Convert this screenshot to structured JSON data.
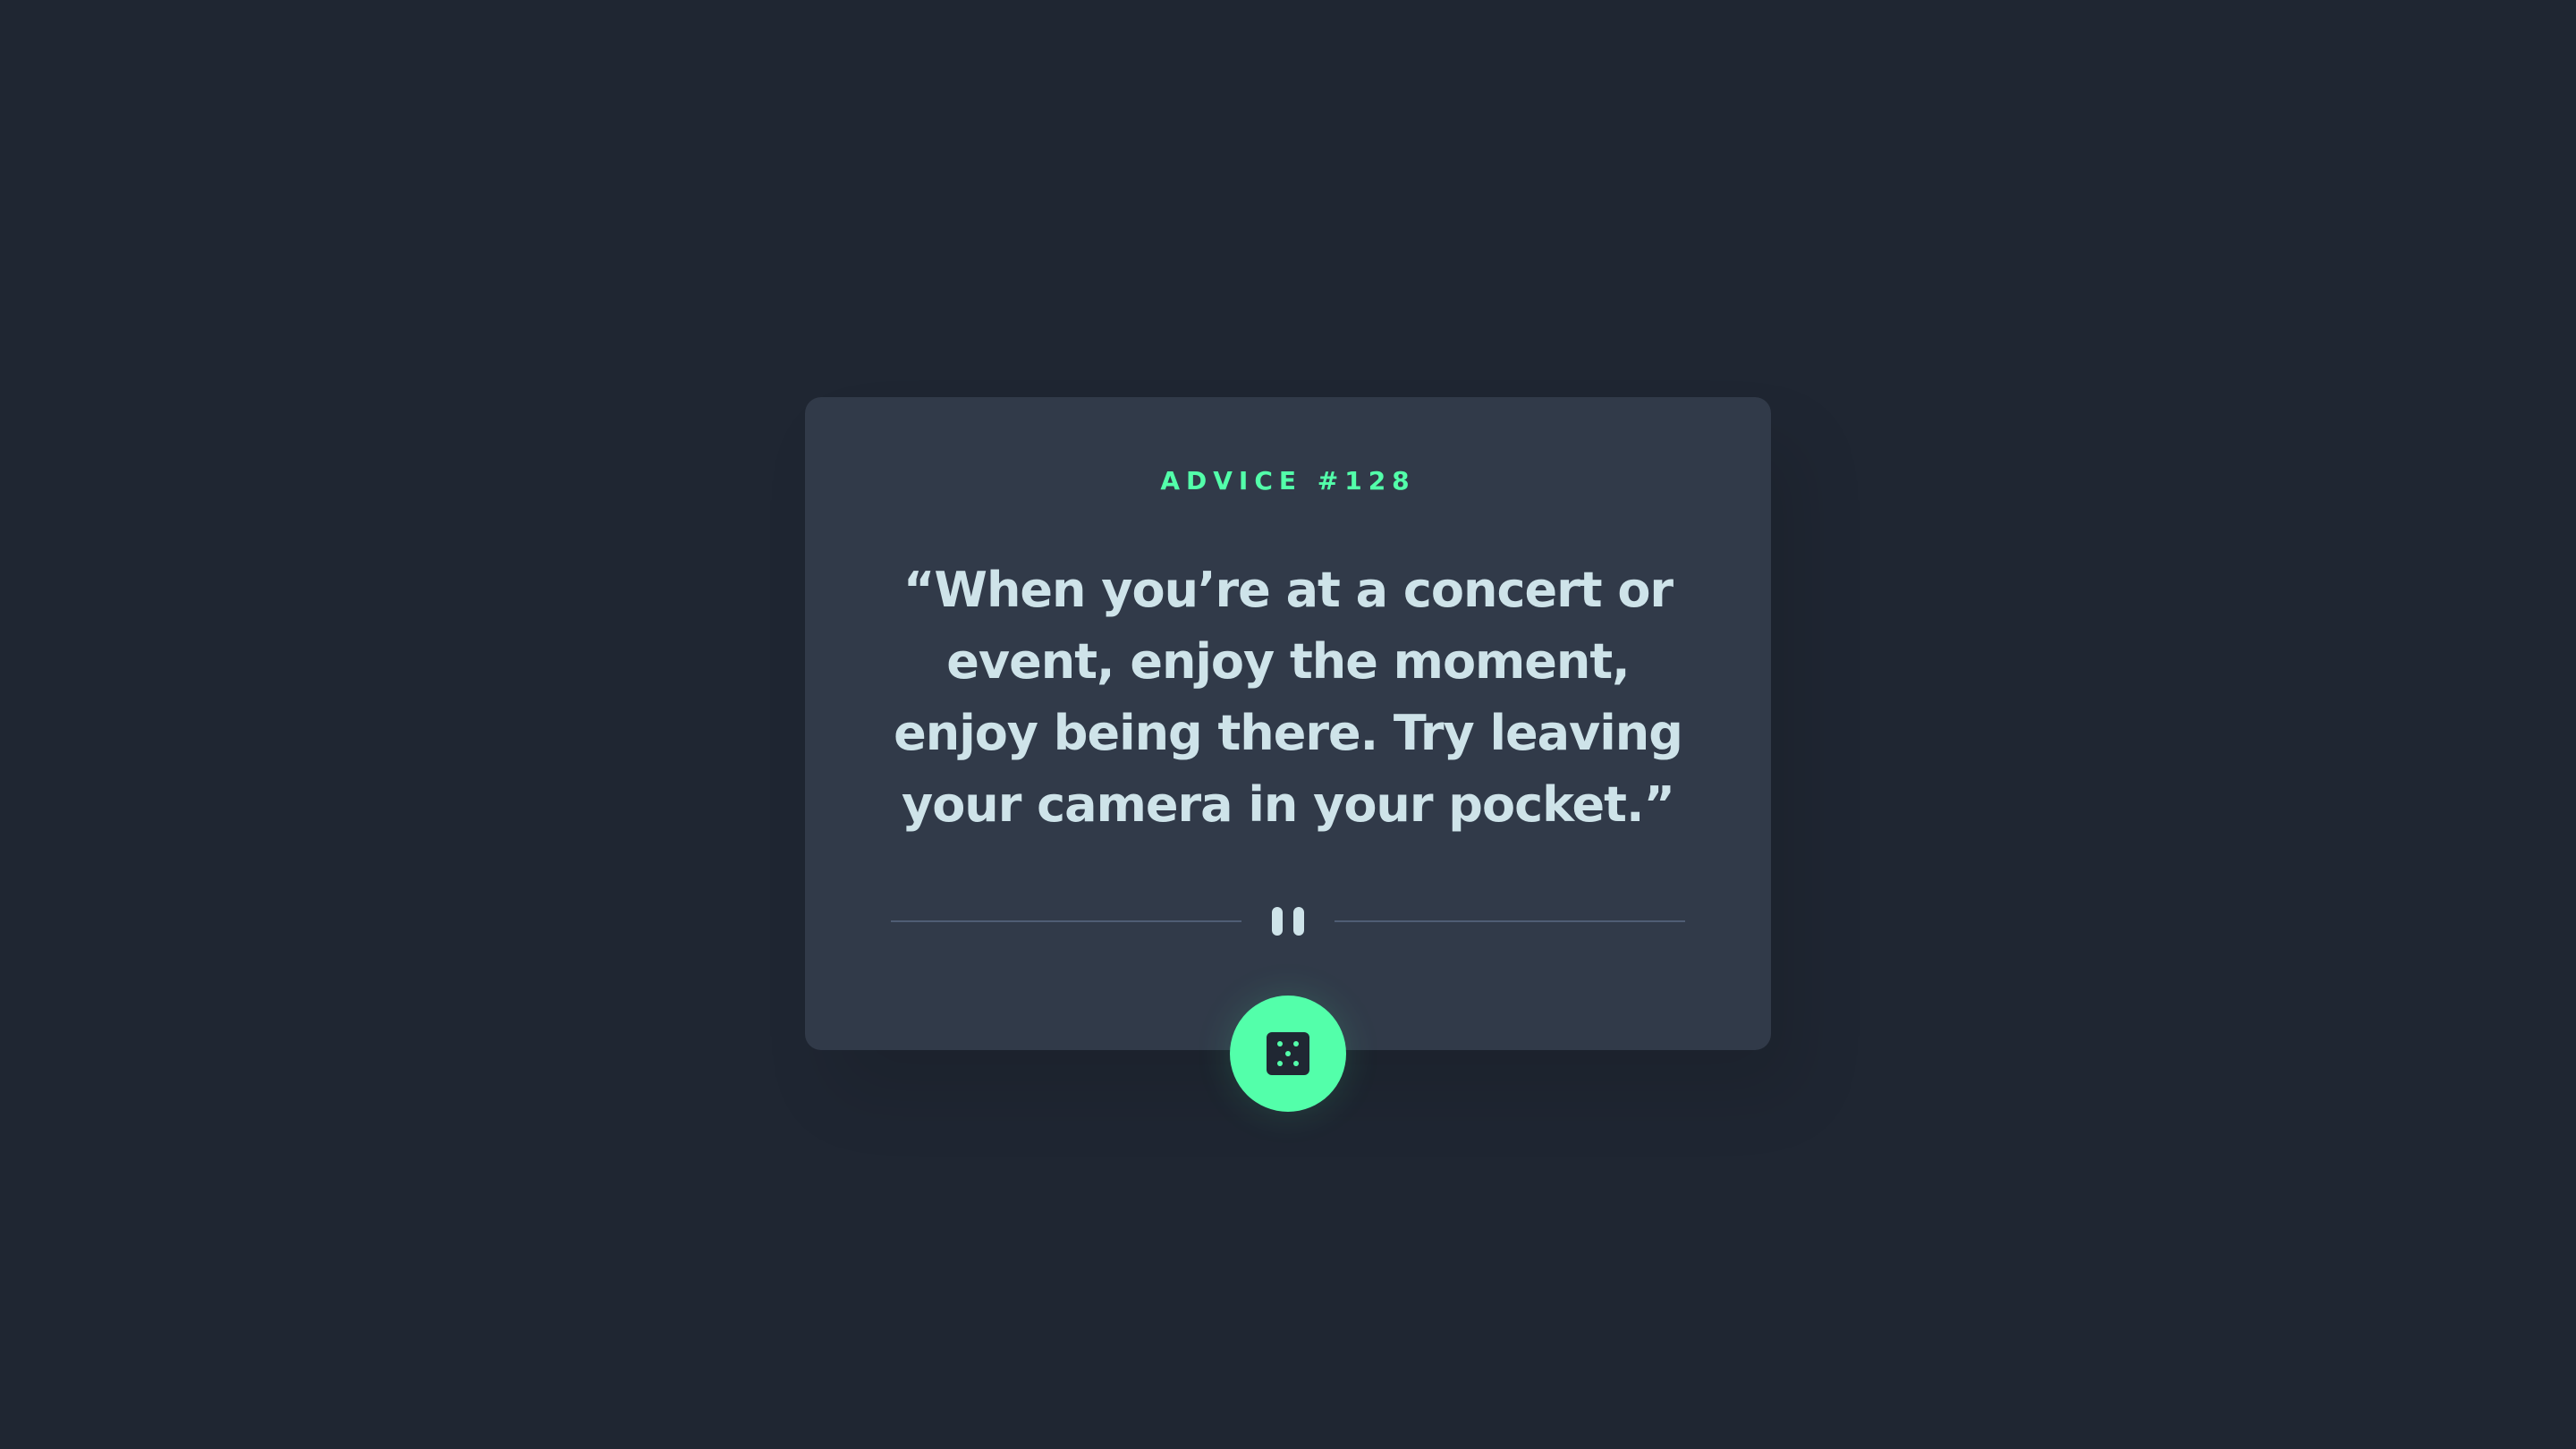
{
  "advice": {
    "label": "ADVICE #128",
    "quote": "“When you’re at a concert or event, enjoy the moment, enjoy being there. Try leaving your camera in your pocket.”"
  },
  "divider": {
    "icon": "pause-icon"
  },
  "button": {
    "icon": "dice-icon"
  },
  "colors": {
    "background": "#1f2632",
    "card": "#313a49",
    "accent": "#53ffaa",
    "text": "#cee3e9",
    "divider": "#4f5d74"
  }
}
